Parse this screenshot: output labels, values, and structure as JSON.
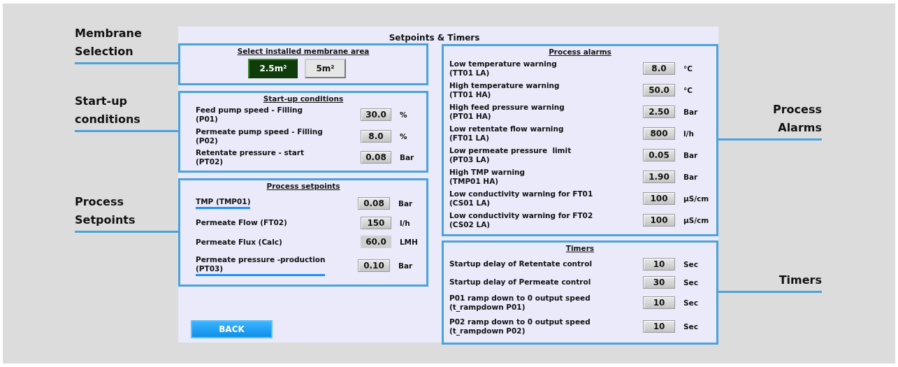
{
  "title": "Setpoints & Timers",
  "left_sections": [
    {
      "kind": "choice",
      "heading": "Select installed membrane area",
      "callout": "Membrane\nSelection",
      "options": [
        {
          "label": "2.5m²",
          "selected": true
        },
        {
          "label": "5m²",
          "selected": false
        }
      ]
    },
    {
      "kind": "rows",
      "heading": "Start-up conditions",
      "callout": "Start-up\nconditions",
      "rows": [
        {
          "label": "Feed pump speed - Filling\n(P01)",
          "value": "30.0",
          "unit": "%",
          "kind": "input",
          "highlighted": false
        },
        {
          "label": "Permeate pump speed - Filling\n(P02)",
          "value": "8.0",
          "unit": "%",
          "kind": "input",
          "highlighted": false
        },
        {
          "label": "Retentate pressure - start\n(PT02)",
          "value": "0.08",
          "unit": "Bar",
          "kind": "input",
          "highlighted": false
        }
      ]
    },
    {
      "kind": "rows",
      "heading": "Process setpoints",
      "callout": "Process\nSetpoints",
      "rows": [
        {
          "label": "TMP (TMP01)",
          "value": "0.08",
          "unit": "Bar",
          "kind": "input",
          "highlighted": true
        },
        {
          "label": "Permeate Flow (FT02)",
          "value": "150",
          "unit": "l/h",
          "kind": "input",
          "highlighted": false
        },
        {
          "label": "Permeate Flux (Calc)",
          "value": "60.0",
          "unit": "LMH",
          "kind": "display",
          "highlighted": false
        },
        {
          "label": "Permeate pressure -production\n(PT03)",
          "value": "0.10",
          "unit": "Bar",
          "kind": "input",
          "highlighted": true
        }
      ]
    }
  ],
  "right_sections": [
    {
      "kind": "rows",
      "heading": "Process alarms",
      "callout": "Process\nAlarms",
      "rows": [
        {
          "label": "Low temperature warning\n(TT01 LA)",
          "value": "8.0",
          "unit": "°C",
          "kind": "input",
          "highlighted": false
        },
        {
          "label": "High temperature warning\n(TT01 HA)",
          "value": "50.0",
          "unit": "°C",
          "kind": "input",
          "highlighted": false
        },
        {
          "label": "High feed pressure warning\n(PT01 HA)",
          "value": "2.50",
          "unit": "Bar",
          "kind": "input",
          "highlighted": false
        },
        {
          "label": "Low retentate flow warning\n(FT01 LA)",
          "value": "800",
          "unit": "l/h",
          "kind": "input",
          "highlighted": false
        },
        {
          "label": "Low permeate pressure  limit\n(PT03 LA)",
          "value": "0.05",
          "unit": "Bar",
          "kind": "input",
          "highlighted": false
        },
        {
          "label": "High TMP warning\n(TMP01 HA)",
          "value": "1.90",
          "unit": "Bar",
          "kind": "input",
          "highlighted": false
        },
        {
          "label": "Low conductivity warning for FT01\n(CS01 LA)",
          "value": "100",
          "unit": "µS/cm",
          "kind": "input",
          "highlighted": false
        },
        {
          "label": "Low conductivity warning for FT02\n(CS02 LA)",
          "value": "100",
          "unit": "µS/cm",
          "kind": "input",
          "highlighted": false
        }
      ]
    },
    {
      "kind": "rows",
      "heading": "Timers",
      "callout": "Timers",
      "rows": [
        {
          "label": "Startup delay of Retentate control",
          "value": "10",
          "unit": "Sec",
          "kind": "input",
          "highlighted": false
        },
        {
          "label": "Startup delay of Permeate control",
          "value": "30",
          "unit": "Sec",
          "kind": "input",
          "highlighted": false
        },
        {
          "label": "P01 ramp down to 0 output speed\n(t_rampdown P01)",
          "value": "10",
          "unit": "Sec",
          "kind": "input",
          "highlighted": false
        },
        {
          "label": "P02 ramp down to 0 output speed\n(t_rampdown P02)",
          "value": "10",
          "unit": "Sec",
          "kind": "input",
          "highlighted": false
        }
      ]
    }
  ],
  "back_button": "BACK"
}
